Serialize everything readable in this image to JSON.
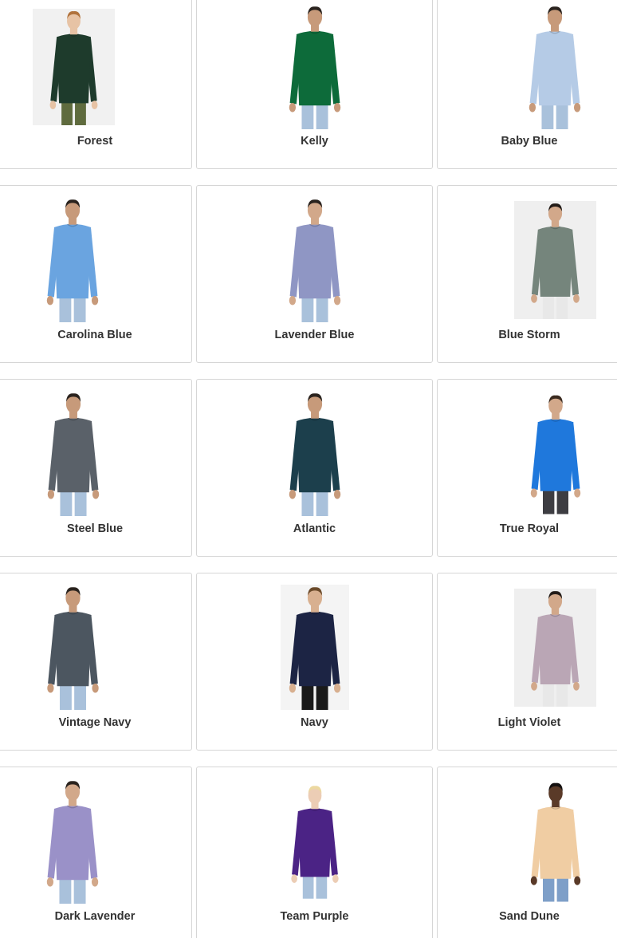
{
  "swatches": [
    {
      "label": "Forest",
      "shirt": "#1e3b2c",
      "pants": "#5f6b3e",
      "skin": "#e7c3a5",
      "hair": "#b0723c",
      "photo_bg": "#f1f1f1"
    },
    {
      "label": "Kelly",
      "shirt": "#0d6b3a",
      "pants": "#a9c1db",
      "skin": "#c79a7a",
      "hair": "#2a231e",
      "photo_bg": "#ffffff"
    },
    {
      "label": "Baby Blue",
      "shirt": "#b5cbe6",
      "pants": "#a9c1db",
      "skin": "#c79a7a",
      "hair": "#2a231e",
      "photo_bg": "#ffffff"
    },
    {
      "label": "Carolina Blue",
      "shirt": "#6aa4e0",
      "pants": "#a9c1db",
      "skin": "#c79a7a",
      "hair": "#2a231e",
      "photo_bg": "#ffffff"
    },
    {
      "label": "Lavender Blue",
      "shirt": "#8f96c4",
      "pants": "#a9c1db",
      "skin": "#d2a88a",
      "hair": "#2a231e",
      "photo_bg": "#ffffff"
    },
    {
      "label": "Blue Storm",
      "shirt": "#75857c",
      "pants": "#e8e8e8",
      "skin": "#d2a88a",
      "hair": "#231c18",
      "photo_bg": "#efefef"
    },
    {
      "label": "Steel Blue",
      "shirt": "#5a6169",
      "pants": "#a9c1db",
      "skin": "#c79a7a",
      "hair": "#2a231e",
      "photo_bg": "#ffffff"
    },
    {
      "label": "Atlantic",
      "shirt": "#1c3f4c",
      "pants": "#a9c1db",
      "skin": "#c79a7a",
      "hair": "#2a231e",
      "photo_bg": "#ffffff"
    },
    {
      "label": "True Royal",
      "shirt": "#1f78dc",
      "pants": "#3d3d42",
      "skin": "#d2a88a",
      "hair": "#3b2b20",
      "photo_bg": "#ffffff"
    },
    {
      "label": "Vintage Navy",
      "shirt": "#4c5660",
      "pants": "#a9c1db",
      "skin": "#c79a7a",
      "hair": "#2a231e",
      "photo_bg": "#ffffff"
    },
    {
      "label": "Navy",
      "shirt": "#1c2444",
      "pants": "#1a1a1a",
      "skin": "#d8b090",
      "hair": "#6b4a2a",
      "photo_bg": "#f4f4f4"
    },
    {
      "label": "Light Violet",
      "shirt": "#baa6b5",
      "pants": "#e8e8e8",
      "skin": "#d2a88a",
      "hair": "#231c18",
      "photo_bg": "#efefef"
    },
    {
      "label": "Dark Lavender",
      "shirt": "#9a91c8",
      "pants": "#a9c1db",
      "skin": "#d2a88a",
      "hair": "#2a231e",
      "photo_bg": "#ffffff"
    },
    {
      "label": "Team Purple",
      "shirt": "#4b2385",
      "pants": "#a9c1db",
      "skin": "#eccdb5",
      "hair": "#ecd8a0",
      "photo_bg": "#ffffff"
    },
    {
      "label": "Sand Dune",
      "shirt": "#f0cda3",
      "pants": "#7e9fc8",
      "skin": "#5a3a28",
      "hair": "#141010",
      "photo_bg": "#ffffff"
    }
  ]
}
